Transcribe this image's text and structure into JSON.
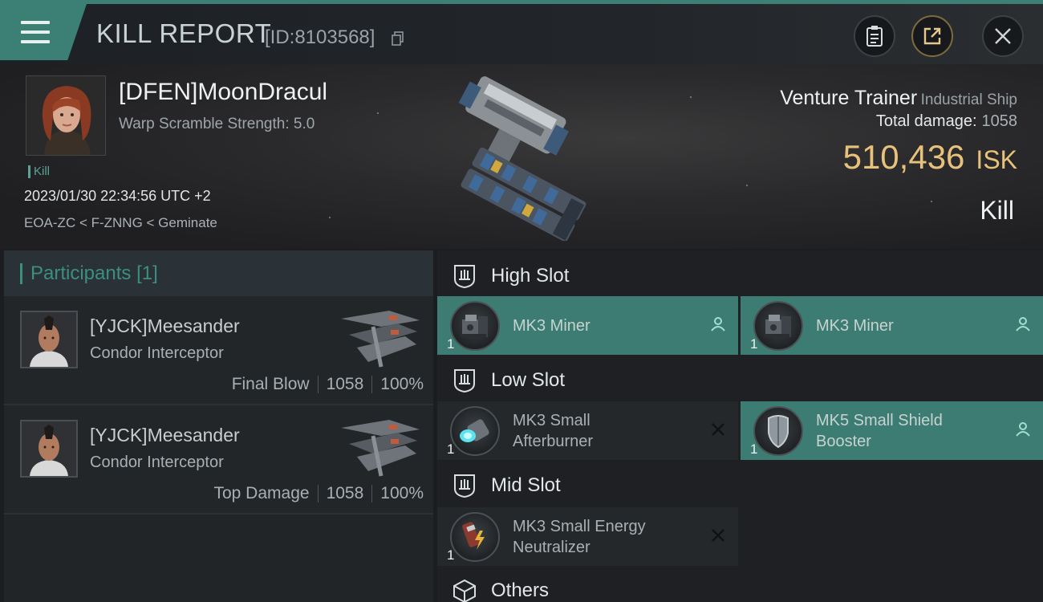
{
  "header": {
    "title": "KILL REPORT",
    "report_id": "[ID:8103568]",
    "icons": [
      "menu-icon",
      "copy-icon",
      "clipboard-icon",
      "share-icon",
      "close-icon"
    ]
  },
  "killmail": {
    "victim_name": "[DFEN]MoonDracul",
    "warp_scramble": "Warp Scramble Strength: 5.0",
    "kill_tag": "Kill",
    "datetime": "2023/01/30 22:34:56 UTC +2",
    "location": "EOA-ZC < F-ZNNG < Geminate",
    "ship_name": "Venture Trainer",
    "ship_class": "Industrial Ship",
    "total_damage_label": "Total damage:",
    "total_damage": "1058",
    "isk_value": "510,436",
    "isk_unit": "ISK",
    "result": "Kill"
  },
  "participants": {
    "title": "Participants",
    "count": "[1]",
    "rows": [
      {
        "name": "[YJCK]Meesander",
        "ship": "Condor Interceptor",
        "role": "Final Blow",
        "damage": "1058",
        "percent": "100%"
      },
      {
        "name": "[YJCK]Meesander",
        "ship": "Condor Interceptor",
        "role": "Top Damage",
        "damage": "1058",
        "percent": "100%"
      }
    ]
  },
  "slots": {
    "high": {
      "label": "High Slot",
      "items": [
        {
          "name_line1": "MK3 Miner",
          "name_line2": "",
          "qty": "1",
          "state": "fitted"
        },
        {
          "name_line1": "MK3 Miner",
          "name_line2": "",
          "qty": "1",
          "state": "fitted"
        }
      ]
    },
    "low": {
      "label": "Low Slot",
      "items": [
        {
          "name_line1": "MK3 Small",
          "name_line2": "Afterburner",
          "qty": "1",
          "state": "destroyed"
        },
        {
          "name_line1": "MK5 Small Shield",
          "name_line2": "Booster",
          "qty": "1",
          "state": "fitted"
        }
      ]
    },
    "mid": {
      "label": "Mid Slot",
      "items": [
        {
          "name_line1": "MK3 Small Energy",
          "name_line2": "Neutralizer",
          "qty": "1",
          "state": "destroyed"
        }
      ]
    },
    "others": {
      "label": "Others"
    }
  },
  "colors": {
    "accent_teal": "#3b7f75",
    "isk_gold": "#e8c27a",
    "panel_dark": "#222528"
  }
}
